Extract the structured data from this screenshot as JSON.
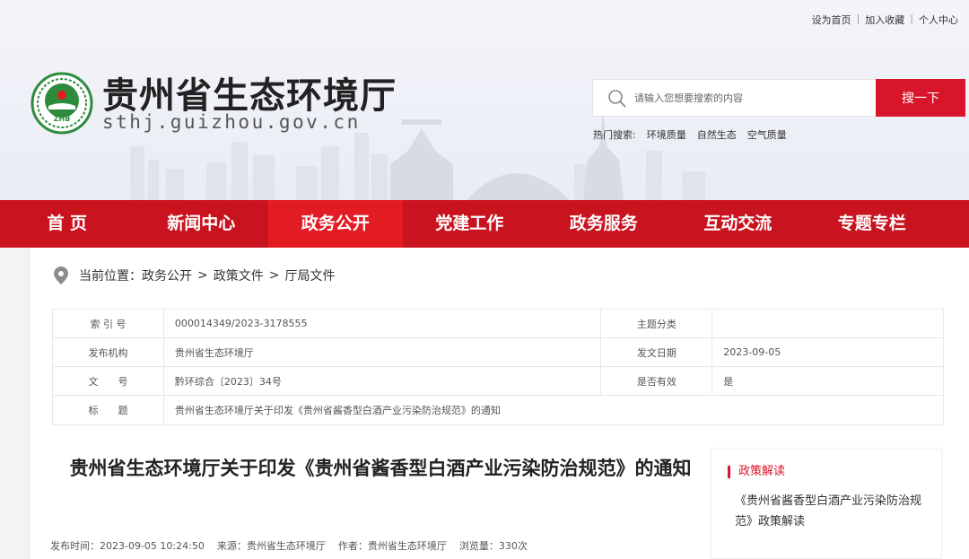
{
  "colors": {
    "brand_red": "#c9131f",
    "nav_active": "#e31b23",
    "search_button": "#d9152b"
  },
  "header": {
    "top_links": [
      "设为首页",
      "加入收藏",
      "个人中心"
    ],
    "site_name": "贵州省生态环境厅",
    "site_domain": "sthj.guizhou.gov.cn",
    "logo_text": "ZHB",
    "search": {
      "placeholder": "请输入您想要搜索的内容",
      "button_label": "搜一下"
    },
    "hot_search": {
      "label": "热门搜索:",
      "items": [
        "环境质量",
        "自然生态",
        "空气质量"
      ]
    }
  },
  "nav": {
    "items": [
      {
        "label": "首 页"
      },
      {
        "label": "新闻中心"
      },
      {
        "label": "政务公开",
        "active": true
      },
      {
        "label": "党建工作"
      },
      {
        "label": "政务服务"
      },
      {
        "label": "互动交流"
      },
      {
        "label": "专题专栏"
      }
    ]
  },
  "breadcrumb": {
    "prefix": "当前位置：",
    "items": [
      "政务公开",
      "政策文件",
      "厅局文件"
    ],
    "separator": ">"
  },
  "meta_table": {
    "rows": [
      {
        "k1": "索 引 号",
        "v1": "000014349/2023-3178555",
        "k2": "主题分类",
        "v2": ""
      },
      {
        "k1": "发布机构",
        "v1": "贵州省生态环境厅",
        "k2": "发文日期",
        "v2": "2023-09-05"
      },
      {
        "k1": "文　　号",
        "v1": "黔环综合〔2023〕34号",
        "k2": "是否有效",
        "v2": "是"
      },
      {
        "k1": "标　　题",
        "v1": "贵州省生态环境厅关于印发《贵州省酱香型白酒产业污染防治规范》的通知"
      }
    ]
  },
  "article": {
    "title": "贵州省生态环境厅关于印发《贵州省酱香型白酒产业污染防治规范》的通知",
    "publish_time": "发布时间：2023-09-05 10:24:50",
    "source": "来源：贵州省生态环境厅",
    "author": "作者：贵州省生态环境厅",
    "views": "浏览量：330次"
  },
  "sidebar": {
    "title": "政策解读",
    "link": "《贵州省酱香型白酒产业污染防治规范》政策解读"
  }
}
